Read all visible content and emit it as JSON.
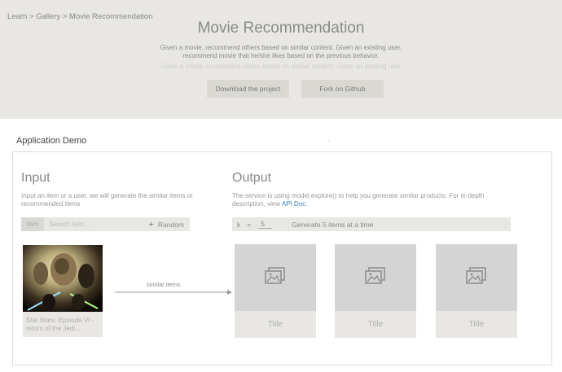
{
  "breadcrumb": "Learn > Gallery > Movie Recommendation",
  "hero": {
    "title": "Movie Recommendation",
    "description": "Given a movie, recommend others based on similar content. Given an existing user, recommend movie that he/she likes based on the previous behavior.",
    "faded_text": "Given a movie, recommend others based on similar content. Given an existing user",
    "download_label": "Download the project",
    "fork_label": "Fork on Github"
  },
  "section": {
    "title": "Application Demo",
    "mark": "-"
  },
  "input": {
    "title": "Input",
    "description": "Input an item or a user, we will generate the similar items or recommended items",
    "tag": "Item",
    "search_placeholder": "Search item...",
    "random_label": "Random",
    "movie_caption": "Star Wars: Episode VI - return of the Jedi..."
  },
  "output": {
    "title": "Output",
    "description_prefix": "The service is using model.explore() to help you generate similar products. For in-depth description, view ",
    "api_link": "API Doc",
    "description_suffix": ".",
    "k_label": "k",
    "k_eq": "=",
    "k_value": "5",
    "generate_text": "Generate 5 items at a time",
    "results": [
      {
        "title": "Title"
      },
      {
        "title": "Title"
      },
      {
        "title": "Title"
      }
    ]
  },
  "arrow_label": "similar items",
  "colors": {
    "hero_bg": "#e8e7e3",
    "link": "#3b86c7",
    "placeholder_bg": "#d4d4d4"
  },
  "icons": {
    "image_placeholder": "image-icon",
    "plus": "plus-icon",
    "arrow": "arrow-right-icon"
  }
}
